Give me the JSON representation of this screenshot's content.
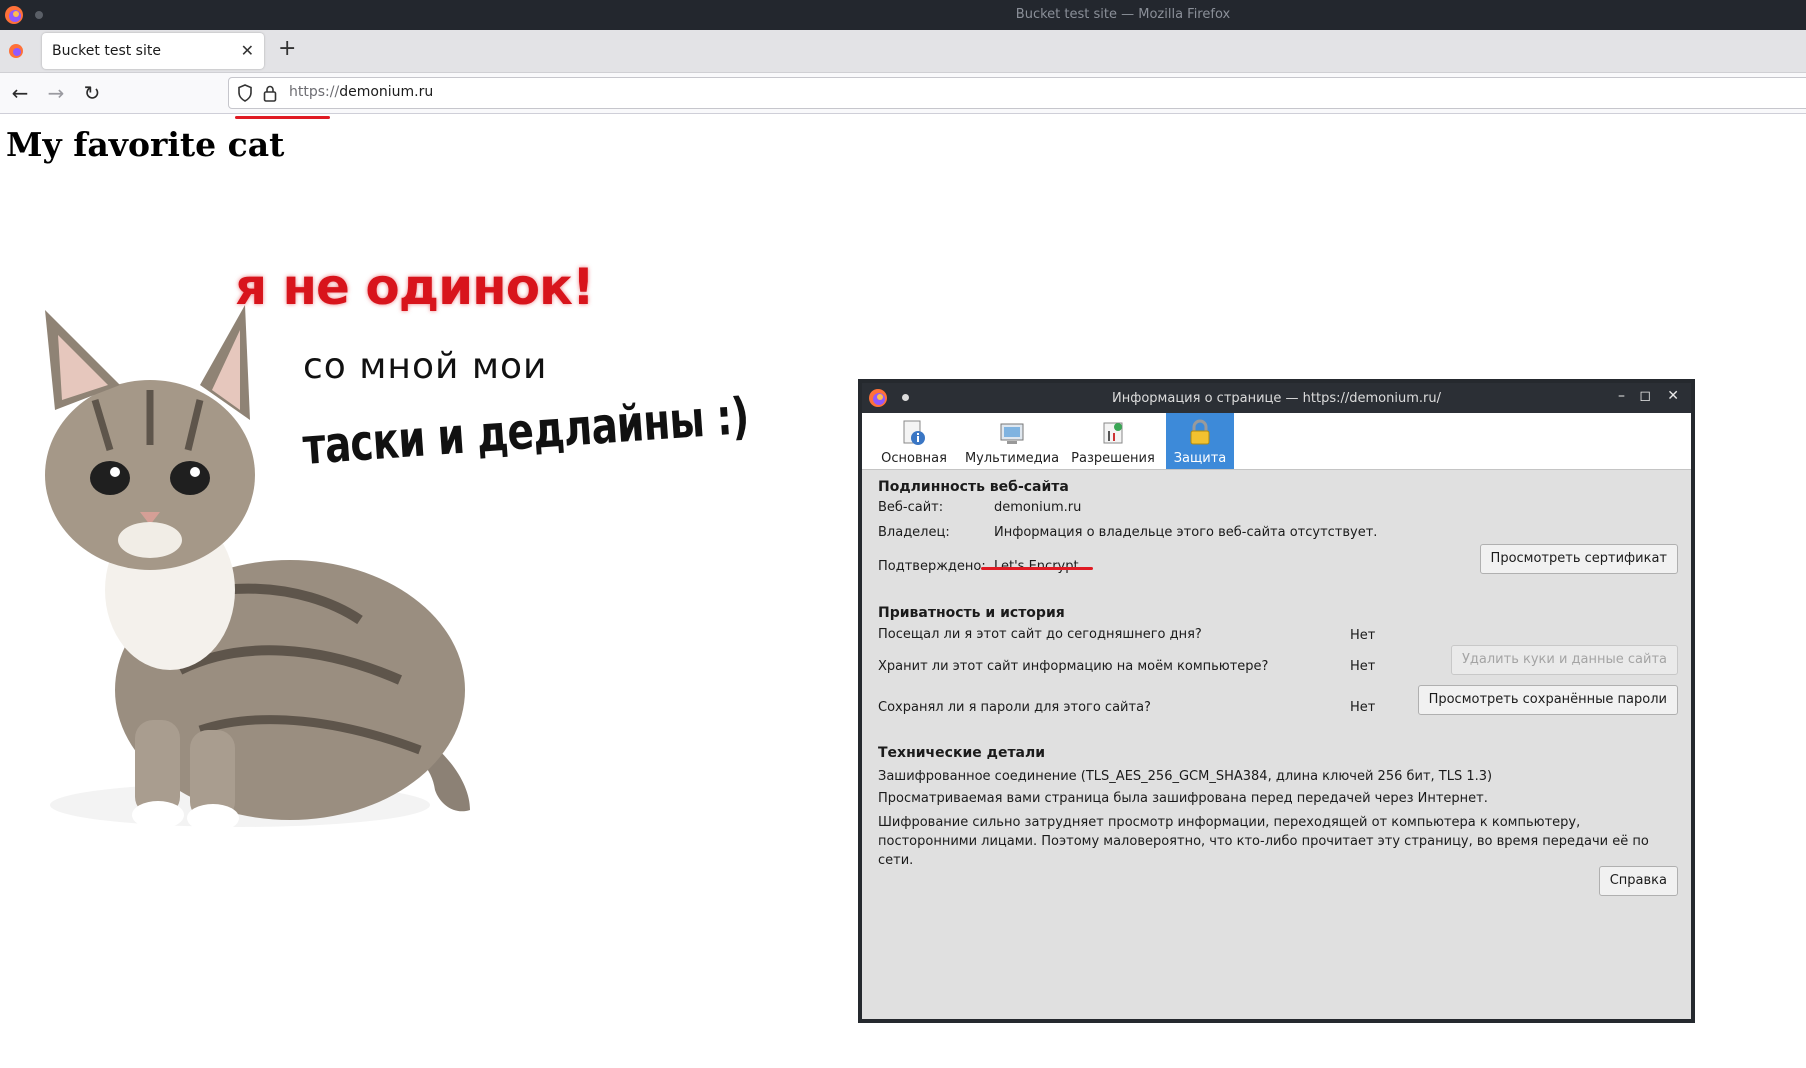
{
  "window": {
    "title": "Bucket test site — Mozilla Firefox"
  },
  "tabs": [
    {
      "label": "Bucket test site"
    }
  ],
  "nav": {
    "url_scheme": "https://",
    "url_host": "demonium.ru"
  },
  "page": {
    "title": "My favorite cat",
    "meme": {
      "line1": "я не одинок!",
      "line2": "со мной мои",
      "line3": "таски и дедлайны :)"
    }
  },
  "dialog": {
    "title": "Информация о странице — https://demonium.ru/",
    "tabs": [
      "Основная",
      "Мультимедиа",
      "Разрешения",
      "Защита"
    ],
    "active_tab": "Защита",
    "identity": {
      "heading": "Подлинность веб-сайта",
      "website_label": "Веб-сайт:",
      "website_value": "demonium.ru",
      "owner_label": "Владелец:",
      "owner_value": "Информация о владельце этого веб-сайта отсутствует.",
      "verified_label": "Подтверждено:",
      "verified_value": "Let's Encrypt",
      "view_cert_button": "Просмотреть сертификат"
    },
    "privacy": {
      "heading": "Приватность и история",
      "q1": "Посещал ли я этот сайт до сегодняшнего дня?",
      "a1": "Нет",
      "q2": "Хранит ли этот сайт информацию на моём компьютере?",
      "a2": "Нет",
      "clear_button": "Удалить куки и данные сайта",
      "q3": "Сохранял ли я пароли для этого сайта?",
      "a3": "Нет",
      "passwords_button": "Просмотреть сохранённые пароли"
    },
    "technical": {
      "heading": "Технические детали",
      "line1": "Зашифрованное соединение (TLS_AES_256_GCM_SHA384, длина ключей 256 бит, TLS 1.3)",
      "line2": "Просматриваемая вами страница была зашифрована перед передачей через Интернет.",
      "line3": "Шифрование сильно затрудняет просмотр информации, переходящей от компьютера к компьютеру, посторонними лицами. Поэтому маловероятно, что кто-либо прочитает эту страницу, во время передачи её по сети.",
      "help_button": "Справка"
    }
  },
  "colors": {
    "accent": "#3d8ad9",
    "annotation_red": "#e01b24",
    "meme_red": "#d8141c"
  }
}
